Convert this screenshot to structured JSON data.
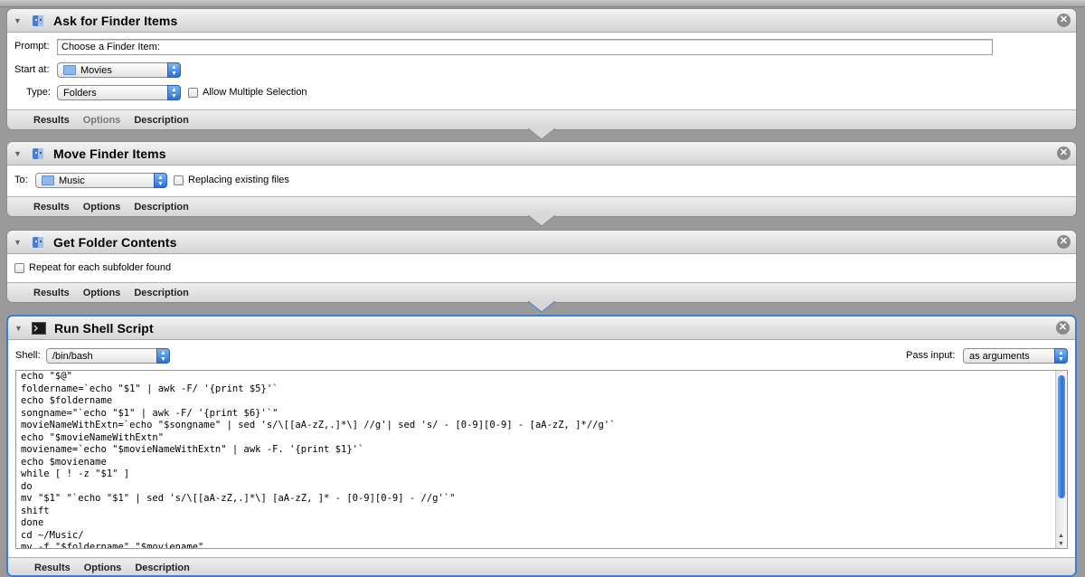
{
  "actions": {
    "ask": {
      "title": "Ask for Finder Items",
      "prompt_label": "Prompt:",
      "prompt_value": "Choose a Finder Item:",
      "start_label": "Start at:",
      "start_value": "Movies",
      "type_label": "Type:",
      "type_value": "Folders",
      "allow_multiple": "Allow Multiple Selection"
    },
    "move": {
      "title": "Move Finder Items",
      "to_label": "To:",
      "to_value": "Music",
      "replacing": "Replacing existing files"
    },
    "get": {
      "title": "Get Folder Contents",
      "repeat": "Repeat for each subfolder found"
    },
    "shell": {
      "title": "Run Shell Script",
      "shell_label": "Shell:",
      "shell_value": "/bin/bash",
      "pass_label": "Pass input:",
      "pass_value": "as arguments",
      "script": "echo \"$@\"\nfoldername=`echo \"$1\" | awk -F/ '{print $5}'`\necho $foldername\nsongname=\"`echo \"$1\" | awk -F/ '{print $6}'`\"\nmovieNameWithExtn=`echo \"$songname\" | sed 's/\\[[aA-zZ,.]*\\] //g'| sed 's/ - [0-9][0-9] - [aA-zZ, ]*//g'`\necho \"$movieNameWithExtn\"\nmoviename=`echo \"$movieNameWithExtn\" | awk -F. '{print $1}'`\necho $moviename\nwhile [ ! -z \"$1\" ]\ndo\nmv \"$1\" \"`echo \"$1\" | sed 's/\\[[aA-zZ,.]*\\] [aA-zZ, ]* - [0-9][0-9] - //g'`\"\nshift\ndone\ncd ~/Music/\nmv -f \"$foldername\" \"$moviename\""
    }
  },
  "bottom_tabs": {
    "results": "Results",
    "options": "Options",
    "description": "Description"
  }
}
